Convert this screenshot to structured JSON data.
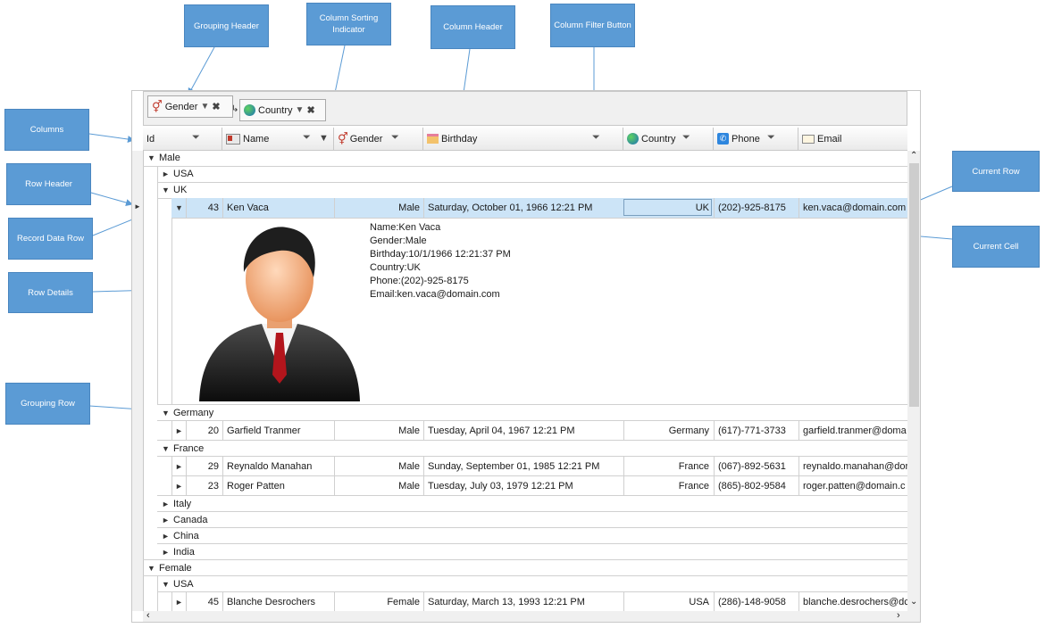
{
  "callouts": {
    "grouping_header": "Grouping Header",
    "sorting_indicator": "Column Sorting Indicator",
    "column_header": "Column Header",
    "filter_button": "Column Filter Button",
    "columns": "Columns",
    "row_header": "Row Header",
    "record_row": "Record Data Row",
    "row_details": "Row Details",
    "grouping_row": "Grouping Row",
    "current_row": "Current Row",
    "current_cell": "Current Cell"
  },
  "group_panel": {
    "chips": [
      {
        "label": "Gender",
        "icon": "gender-icon"
      },
      {
        "label": "Country",
        "icon": "globe-icon"
      }
    ]
  },
  "columns": [
    {
      "label": "Id"
    },
    {
      "label": "Name",
      "icon": "id-card-icon"
    },
    {
      "label": "Gender",
      "icon": "gender-icon"
    },
    {
      "label": "Birthday",
      "icon": "cake-icon"
    },
    {
      "label": "Country",
      "icon": "globe-icon"
    },
    {
      "label": "Phone",
      "icon": "phone-icon"
    },
    {
      "label": "Email",
      "icon": "envelope-icon"
    }
  ],
  "groups": {
    "male": "Male",
    "usa": "USA",
    "uk": "UK",
    "germany": "Germany",
    "france": "France",
    "italy": "Italy",
    "canada": "Canada",
    "china": "China",
    "india": "India",
    "female": "Female",
    "usa2": "USA"
  },
  "rows": [
    {
      "id": "43",
      "name": "Ken Vaca",
      "gender": "Male",
      "birthday": "Saturday, October 01, 1966 12:21 PM",
      "country": "UK",
      "phone": "(202)-925-8175",
      "email": "ken.vaca@domain.com"
    },
    {
      "id": "20",
      "name": "Garfield Tranmer",
      "gender": "Male",
      "birthday": "Tuesday, April 04, 1967 12:21 PM",
      "country": "Germany",
      "phone": "(617)-771-3733",
      "email": "garfield.tranmer@doma"
    },
    {
      "id": "29",
      "name": "Reynaldo Manahan",
      "gender": "Male",
      "birthday": "Sunday, September 01, 1985 12:21 PM",
      "country": "France",
      "phone": "(067)-892-5631",
      "email": "reynaldo.manahan@dor"
    },
    {
      "id": "23",
      "name": "Roger Patten",
      "gender": "Male",
      "birthday": "Tuesday, July 03, 1979 12:21 PM",
      "country": "France",
      "phone": "(865)-802-9584",
      "email": "roger.patten@domain.c"
    },
    {
      "id": "45",
      "name": "Blanche Desrochers",
      "gender": "Female",
      "birthday": "Saturday, March 13, 1993 12:21 PM",
      "country": "USA",
      "phone": "(286)-148-9058",
      "email": "blanche.desrochers@dc"
    }
  ],
  "details": {
    "name": "Name:Ken Vaca",
    "gender": "Gender:Male",
    "birthday": "Birthday:10/1/1966 12:21:37 PM",
    "country": "Country:UK",
    "phone": "Phone:(202)-925-8175",
    "email": "Email:ken.vaca@domain.com"
  },
  "colors": {
    "callout": "#5b9bd5",
    "current_row": "#cce4f7",
    "arrow": "#5b9bd5"
  }
}
